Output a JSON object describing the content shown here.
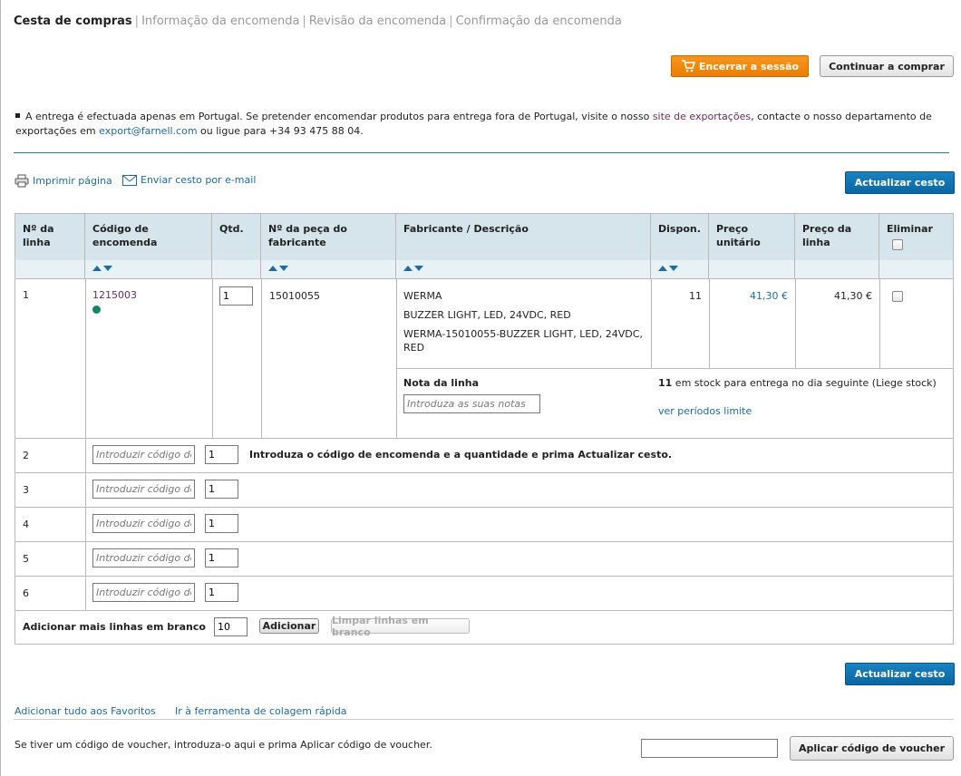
{
  "steps": {
    "active": "Cesta de compras",
    "items": [
      "Informação da encomenda",
      "Revisão da encomenda",
      "Confirmação da encomenda"
    ]
  },
  "header_buttons": {
    "logout": "Encerrar a sessão",
    "continue": "Continuar a comprar"
  },
  "notice": {
    "part1": "A entrega é efectuada apenas em Portugal. Se pretender encomendar produtos para entrega fora de Portugal, visite o nosso ",
    "link_exports": "site de exportações",
    "part2": ", contacte o nosso departamento de exportações em ",
    "email": "export@farnell.com",
    "part3": " ou ligue para +34 93 475 88 04."
  },
  "tools": {
    "print": "Imprimir página",
    "email": "Enviar cesto por e-mail",
    "update": "Actualizar cesto"
  },
  "table": {
    "headers": {
      "line": "Nº da linha",
      "order_code": "Código de encomenda",
      "qty": "Qtd.",
      "mfr_part": "Nº da peça do fabricante",
      "mfr_desc": "Fabricante / Descrição",
      "avail": "Dispon.",
      "unit_price": "Preço unitário",
      "line_price": "Preço da linha",
      "delete": "Eliminar"
    },
    "item": {
      "line": "1",
      "order_code": "1215003",
      "qty": "1",
      "mfr_part": "15010055",
      "manufacturer": "WERMA",
      "desc1": "BUZZER LIGHT, LED, 24VDC, RED",
      "desc2": "WERMA-15010055-BUZZER LIGHT, LED, 24VDC, RED",
      "avail": "11",
      "unit_price": "41,30 €",
      "line_price": "41,30 €",
      "note_label": "Nota da linha",
      "note_placeholder": "Introduza as suas notas",
      "stock_count": "11",
      "stock_text": " em stock para entrega no dia seguinte (Liege stock)",
      "cutoff_link": "ver períodos limite"
    },
    "blank_rows": [
      {
        "line": "2",
        "qty": "1"
      },
      {
        "line": "3",
        "qty": "1"
      },
      {
        "line": "4",
        "qty": "1"
      },
      {
        "line": "5",
        "qty": "1"
      },
      {
        "line": "6",
        "qty": "1"
      }
    ],
    "code_placeholder": "Introduzir código de encomenda",
    "instruction": "Introduza o código de encomenda e a quantidade e prima Actualizar cesto.",
    "add_lines_label": "Adicionar mais linhas em branco",
    "add_lines_value": "10",
    "add_button": "Adicionar",
    "clear_button": "Limpar linhas em branco"
  },
  "bottom": {
    "update": "Actualizar cesto",
    "add_favorites": "Adicionar tudo aos Favoritos",
    "quick_paste": "Ir à ferramenta de colagem rápida",
    "voucher_text": "Se tiver um código de voucher, introduza-o aqui e prima Aplicar código de voucher.",
    "voucher_button": "Aplicar código de voucher"
  },
  "colors": {
    "accent_blue": "#0a66a3",
    "orange": "#ed7d00",
    "header_bg": "#d6e5ec",
    "in_stock": "#13866a"
  }
}
